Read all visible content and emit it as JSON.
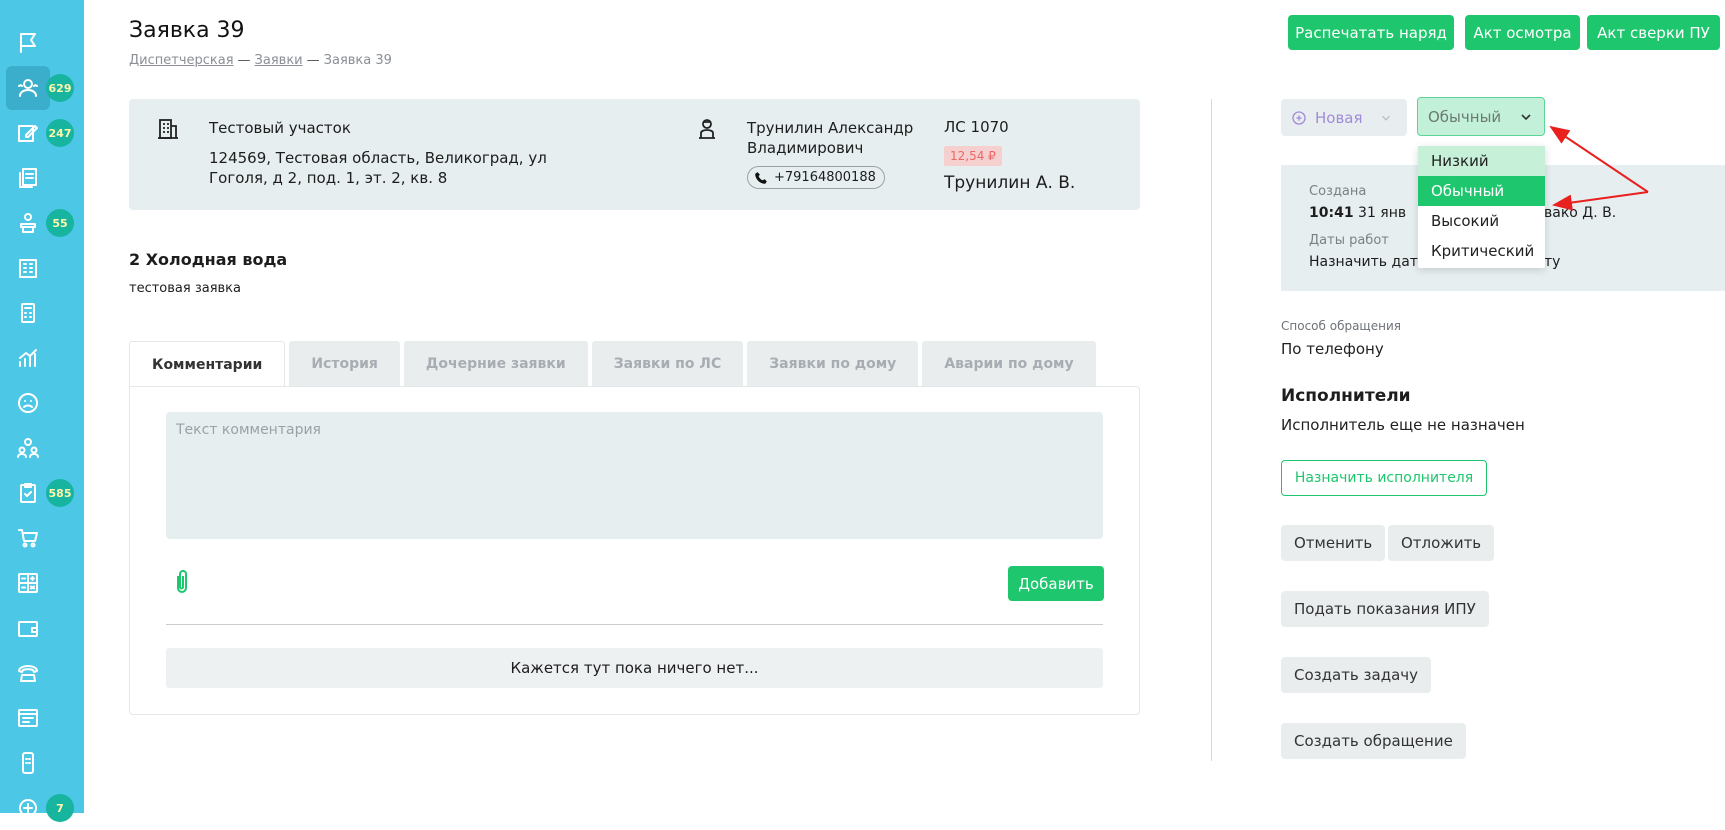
{
  "page": {
    "title": "Заявка 39",
    "breadcrumb": [
      "Диспетчерская",
      "Заявки",
      "Заявка 39"
    ]
  },
  "sidebar": {
    "items": [
      {
        "icon": "flag-icon",
        "badge": ""
      },
      {
        "icon": "users-icon",
        "badge": "629"
      },
      {
        "icon": "edit-icon",
        "badge": "247"
      },
      {
        "icon": "documents-icon",
        "badge": ""
      },
      {
        "icon": "worker-icon",
        "badge": "55"
      },
      {
        "icon": "building-icon",
        "badge": ""
      },
      {
        "icon": "calculator-icon",
        "badge": ""
      },
      {
        "icon": "chart-icon",
        "badge": ""
      },
      {
        "icon": "sad-face-icon",
        "badge": ""
      },
      {
        "icon": "group-icon",
        "badge": ""
      },
      {
        "icon": "clipboard-check-icon",
        "badge": "585"
      },
      {
        "icon": "cart-icon",
        "badge": ""
      },
      {
        "icon": "calc-grid-icon",
        "badge": ""
      },
      {
        "icon": "wallet-icon",
        "badge": ""
      },
      {
        "icon": "phone-icon",
        "badge": ""
      },
      {
        "icon": "browser-icon",
        "badge": ""
      },
      {
        "icon": "mobile-icon",
        "badge": ""
      },
      {
        "icon": "add-chat-icon",
        "badge": "7"
      }
    ]
  },
  "toolbar": {
    "print_order": "Распечатать наряд",
    "inspection_act": "Акт осмотра",
    "reconciliation_act": "Акт сверки ПУ"
  },
  "info": {
    "site_name": "Тестовый участок",
    "address": "124569, Тестовая область, Великоград, ул Гоголя, д 2, под. 1, эт. 2, кв. 8",
    "resident_name": "Трунилин Александр Владимирович",
    "phone": "+79164800188",
    "account": "ЛС 1070",
    "debt": "12,54 ₽",
    "owner_short": "Трунилин А. В."
  },
  "request": {
    "title": "2 Холодная вода",
    "description": "тестовая заявка"
  },
  "tabs": [
    "Комментарии",
    "История",
    "Дочерние заявки",
    "Заявки по ЛС",
    "Заявки по дому",
    "Аварии по дому"
  ],
  "comments": {
    "placeholder": "Текст комментария",
    "add_label": "Добавить",
    "empty_text": "Кажется тут пока ничего нет..."
  },
  "status": {
    "value": "Новая",
    "priority": "Обычный",
    "priority_options": [
      "Низкий",
      "Обычный",
      "Высокий",
      "Критический"
    ]
  },
  "dates": {
    "created_label": "Создана",
    "created_time": "10:41",
    "created_date": "31 янв",
    "created_by_tail": "вако Д. В.",
    "work_dates_label": "Даты работ",
    "work_dates_value_start": "Назначить дат",
    "work_dates_value_end": "ту"
  },
  "contact_method": {
    "label": "Способ обращения",
    "value": "По телефону"
  },
  "executors": {
    "title": "Исполнители",
    "status": "Исполнитель еще не назначен",
    "assign_label": "Назначить исполнителя"
  },
  "actions": {
    "cancel": "Отменить",
    "postpone": "Отложить",
    "submit_readings": "Подать показания ИПУ",
    "create_task": "Создать задачу",
    "create_appeal": "Создать обращение"
  },
  "colors": {
    "sidebar": "#4cc7e6",
    "accent": "#1ec66e",
    "badge": "#17b4a0",
    "annotation_arrow": "#e8201e"
  }
}
